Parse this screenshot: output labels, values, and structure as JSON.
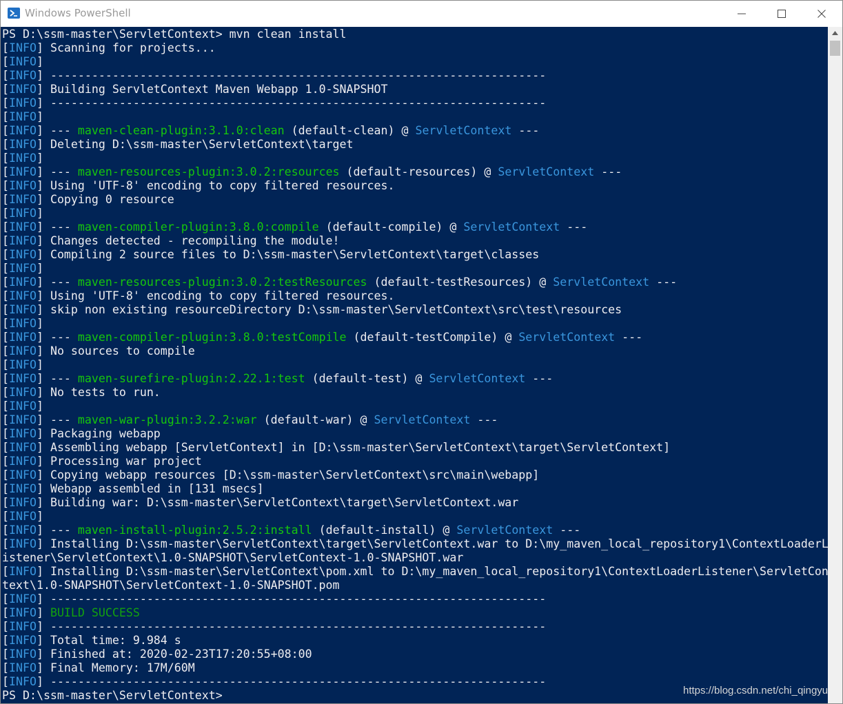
{
  "window": {
    "title": "Windows PowerShell",
    "app_icon": "powershell-icon",
    "controls": [
      "minimize-icon",
      "maximize-icon",
      "close-icon"
    ]
  },
  "colors": {
    "console_bg": "#012456",
    "text": "#eeedf0",
    "info_tag": "#3a96dd",
    "plugin": "#16c60c",
    "success": "#13a10e",
    "project": "#3a96dd"
  },
  "console": {
    "lines": [
      [
        {
          "t": "PS D:\\ssm-master\\ServletContext> mvn clean install",
          "c": "normal"
        }
      ],
      [
        {
          "t": "[",
          "c": "normal"
        },
        {
          "t": "INFO",
          "c": "blue"
        },
        {
          "t": "] Scanning for projects...",
          "c": "normal"
        }
      ],
      [
        {
          "t": "[",
          "c": "normal"
        },
        {
          "t": "INFO",
          "c": "blue"
        },
        {
          "t": "]",
          "c": "normal"
        }
      ],
      [
        {
          "t": "[",
          "c": "normal"
        },
        {
          "t": "INFO",
          "c": "blue"
        },
        {
          "t": "] ------------------------------------------------------------------------",
          "c": "normal"
        }
      ],
      [
        {
          "t": "[",
          "c": "normal"
        },
        {
          "t": "INFO",
          "c": "blue"
        },
        {
          "t": "] Building ServletContext Maven Webapp 1.0-SNAPSHOT",
          "c": "normal"
        }
      ],
      [
        {
          "t": "[",
          "c": "normal"
        },
        {
          "t": "INFO",
          "c": "blue"
        },
        {
          "t": "] ------------------------------------------------------------------------",
          "c": "normal"
        }
      ],
      [
        {
          "t": "[",
          "c": "normal"
        },
        {
          "t": "INFO",
          "c": "blue"
        },
        {
          "t": "]",
          "c": "normal"
        }
      ],
      [
        {
          "t": "[",
          "c": "normal"
        },
        {
          "t": "INFO",
          "c": "blue"
        },
        {
          "t": "] --- ",
          "c": "normal"
        },
        {
          "t": "maven-clean-plugin:3.1.0:clean",
          "c": "plug"
        },
        {
          "t": " (default-clean) @ ",
          "c": "normal"
        },
        {
          "t": "ServletContext",
          "c": "blue"
        },
        {
          "t": " ---",
          "c": "normal"
        }
      ],
      [
        {
          "t": "[",
          "c": "normal"
        },
        {
          "t": "INFO",
          "c": "blue"
        },
        {
          "t": "] Deleting D:\\ssm-master\\ServletContext\\target",
          "c": "normal"
        }
      ],
      [
        {
          "t": "[",
          "c": "normal"
        },
        {
          "t": "INFO",
          "c": "blue"
        },
        {
          "t": "]",
          "c": "normal"
        }
      ],
      [
        {
          "t": "[",
          "c": "normal"
        },
        {
          "t": "INFO",
          "c": "blue"
        },
        {
          "t": "] --- ",
          "c": "normal"
        },
        {
          "t": "maven-resources-plugin:3.0.2:resources",
          "c": "plug"
        },
        {
          "t": " (default-resources) @ ",
          "c": "normal"
        },
        {
          "t": "ServletContext",
          "c": "blue"
        },
        {
          "t": " ---",
          "c": "normal"
        }
      ],
      [
        {
          "t": "[",
          "c": "normal"
        },
        {
          "t": "INFO",
          "c": "blue"
        },
        {
          "t": "] Using 'UTF-8' encoding to copy filtered resources.",
          "c": "normal"
        }
      ],
      [
        {
          "t": "[",
          "c": "normal"
        },
        {
          "t": "INFO",
          "c": "blue"
        },
        {
          "t": "] Copying 0 resource",
          "c": "normal"
        }
      ],
      [
        {
          "t": "[",
          "c": "normal"
        },
        {
          "t": "INFO",
          "c": "blue"
        },
        {
          "t": "]",
          "c": "normal"
        }
      ],
      [
        {
          "t": "[",
          "c": "normal"
        },
        {
          "t": "INFO",
          "c": "blue"
        },
        {
          "t": "] --- ",
          "c": "normal"
        },
        {
          "t": "maven-compiler-plugin:3.8.0:compile",
          "c": "plug"
        },
        {
          "t": " (default-compile) @ ",
          "c": "normal"
        },
        {
          "t": "ServletContext",
          "c": "blue"
        },
        {
          "t": " ---",
          "c": "normal"
        }
      ],
      [
        {
          "t": "[",
          "c": "normal"
        },
        {
          "t": "INFO",
          "c": "blue"
        },
        {
          "t": "] Changes detected - recompiling the module!",
          "c": "normal"
        }
      ],
      [
        {
          "t": "[",
          "c": "normal"
        },
        {
          "t": "INFO",
          "c": "blue"
        },
        {
          "t": "] Compiling 2 source files to D:\\ssm-master\\ServletContext\\target\\classes",
          "c": "normal"
        }
      ],
      [
        {
          "t": "[",
          "c": "normal"
        },
        {
          "t": "INFO",
          "c": "blue"
        },
        {
          "t": "]",
          "c": "normal"
        }
      ],
      [
        {
          "t": "[",
          "c": "normal"
        },
        {
          "t": "INFO",
          "c": "blue"
        },
        {
          "t": "] --- ",
          "c": "normal"
        },
        {
          "t": "maven-resources-plugin:3.0.2:testResources",
          "c": "plug"
        },
        {
          "t": " (default-testResources) @ ",
          "c": "normal"
        },
        {
          "t": "ServletContext",
          "c": "blue"
        },
        {
          "t": " ---",
          "c": "normal"
        }
      ],
      [
        {
          "t": "[",
          "c": "normal"
        },
        {
          "t": "INFO",
          "c": "blue"
        },
        {
          "t": "] Using 'UTF-8' encoding to copy filtered resources.",
          "c": "normal"
        }
      ],
      [
        {
          "t": "[",
          "c": "normal"
        },
        {
          "t": "INFO",
          "c": "blue"
        },
        {
          "t": "] skip non existing resourceDirectory D:\\ssm-master\\ServletContext\\src\\test\\resources",
          "c": "normal"
        }
      ],
      [
        {
          "t": "[",
          "c": "normal"
        },
        {
          "t": "INFO",
          "c": "blue"
        },
        {
          "t": "]",
          "c": "normal"
        }
      ],
      [
        {
          "t": "[",
          "c": "normal"
        },
        {
          "t": "INFO",
          "c": "blue"
        },
        {
          "t": "] --- ",
          "c": "normal"
        },
        {
          "t": "maven-compiler-plugin:3.8.0:testCompile",
          "c": "plug"
        },
        {
          "t": " (default-testCompile) @ ",
          "c": "normal"
        },
        {
          "t": "ServletContext",
          "c": "blue"
        },
        {
          "t": " ---",
          "c": "normal"
        }
      ],
      [
        {
          "t": "[",
          "c": "normal"
        },
        {
          "t": "INFO",
          "c": "blue"
        },
        {
          "t": "] No sources to compile",
          "c": "normal"
        }
      ],
      [
        {
          "t": "[",
          "c": "normal"
        },
        {
          "t": "INFO",
          "c": "blue"
        },
        {
          "t": "]",
          "c": "normal"
        }
      ],
      [
        {
          "t": "[",
          "c": "normal"
        },
        {
          "t": "INFO",
          "c": "blue"
        },
        {
          "t": "] --- ",
          "c": "normal"
        },
        {
          "t": "maven-surefire-plugin:2.22.1:test",
          "c": "plug"
        },
        {
          "t": " (default-test) @ ",
          "c": "normal"
        },
        {
          "t": "ServletContext",
          "c": "blue"
        },
        {
          "t": " ---",
          "c": "normal"
        }
      ],
      [
        {
          "t": "[",
          "c": "normal"
        },
        {
          "t": "INFO",
          "c": "blue"
        },
        {
          "t": "] No tests to run.",
          "c": "normal"
        }
      ],
      [
        {
          "t": "[",
          "c": "normal"
        },
        {
          "t": "INFO",
          "c": "blue"
        },
        {
          "t": "]",
          "c": "normal"
        }
      ],
      [
        {
          "t": "[",
          "c": "normal"
        },
        {
          "t": "INFO",
          "c": "blue"
        },
        {
          "t": "] --- ",
          "c": "normal"
        },
        {
          "t": "maven-war-plugin:3.2.2:war",
          "c": "plug"
        },
        {
          "t": " (default-war) @ ",
          "c": "normal"
        },
        {
          "t": "ServletContext",
          "c": "blue"
        },
        {
          "t": " ---",
          "c": "normal"
        }
      ],
      [
        {
          "t": "[",
          "c": "normal"
        },
        {
          "t": "INFO",
          "c": "blue"
        },
        {
          "t": "] Packaging webapp",
          "c": "normal"
        }
      ],
      [
        {
          "t": "[",
          "c": "normal"
        },
        {
          "t": "INFO",
          "c": "blue"
        },
        {
          "t": "] Assembling webapp [ServletContext] in [D:\\ssm-master\\ServletContext\\target\\ServletContext]",
          "c": "normal"
        }
      ],
      [
        {
          "t": "[",
          "c": "normal"
        },
        {
          "t": "INFO",
          "c": "blue"
        },
        {
          "t": "] Processing war project",
          "c": "normal"
        }
      ],
      [
        {
          "t": "[",
          "c": "normal"
        },
        {
          "t": "INFO",
          "c": "blue"
        },
        {
          "t": "] Copying webapp resources [D:\\ssm-master\\ServletContext\\src\\main\\webapp]",
          "c": "normal"
        }
      ],
      [
        {
          "t": "[",
          "c": "normal"
        },
        {
          "t": "INFO",
          "c": "blue"
        },
        {
          "t": "] Webapp assembled in [131 msecs]",
          "c": "normal"
        }
      ],
      [
        {
          "t": "[",
          "c": "normal"
        },
        {
          "t": "INFO",
          "c": "blue"
        },
        {
          "t": "] Building war: D:\\ssm-master\\ServletContext\\target\\ServletContext.war",
          "c": "normal"
        }
      ],
      [
        {
          "t": "[",
          "c": "normal"
        },
        {
          "t": "INFO",
          "c": "blue"
        },
        {
          "t": "]",
          "c": "normal"
        }
      ],
      [
        {
          "t": "[",
          "c": "normal"
        },
        {
          "t": "INFO",
          "c": "blue"
        },
        {
          "t": "] --- ",
          "c": "normal"
        },
        {
          "t": "maven-install-plugin:2.5.2:install",
          "c": "plug"
        },
        {
          "t": " (default-install) @ ",
          "c": "normal"
        },
        {
          "t": "ServletContext",
          "c": "blue"
        },
        {
          "t": " ---",
          "c": "normal"
        }
      ],
      [
        {
          "t": "[",
          "c": "normal"
        },
        {
          "t": "INFO",
          "c": "blue"
        },
        {
          "t": "] Installing D:\\ssm-master\\ServletContext\\target\\ServletContext.war to D:\\my_maven_local_repository1\\ContextLoaderL",
          "c": "normal"
        }
      ],
      [
        {
          "t": "istener\\ServletContext\\1.0-SNAPSHOT\\ServletContext-1.0-SNAPSHOT.war",
          "c": "normal"
        }
      ],
      [
        {
          "t": "[",
          "c": "normal"
        },
        {
          "t": "INFO",
          "c": "blue"
        },
        {
          "t": "] Installing D:\\ssm-master\\ServletContext\\pom.xml to D:\\my_maven_local_repository1\\ContextLoaderListener\\ServletCon",
          "c": "normal"
        }
      ],
      [
        {
          "t": "text\\1.0-SNAPSHOT\\ServletContext-1.0-SNAPSHOT.pom",
          "c": "normal"
        }
      ],
      [
        {
          "t": "[",
          "c": "normal"
        },
        {
          "t": "INFO",
          "c": "blue"
        },
        {
          "t": "] ------------------------------------------------------------------------",
          "c": "normal"
        }
      ],
      [
        {
          "t": "[",
          "c": "normal"
        },
        {
          "t": "INFO",
          "c": "blue"
        },
        {
          "t": "] ",
          "c": "normal"
        },
        {
          "t": "BUILD SUCCESS",
          "c": "green"
        }
      ],
      [
        {
          "t": "[",
          "c": "normal"
        },
        {
          "t": "INFO",
          "c": "blue"
        },
        {
          "t": "] ------------------------------------------------------------------------",
          "c": "normal"
        }
      ],
      [
        {
          "t": "[",
          "c": "normal"
        },
        {
          "t": "INFO",
          "c": "blue"
        },
        {
          "t": "] Total time: 9.984 s",
          "c": "normal"
        }
      ],
      [
        {
          "t": "[",
          "c": "normal"
        },
        {
          "t": "INFO",
          "c": "blue"
        },
        {
          "t": "] Finished at: 2020-02-23T17:20:55+08:00",
          "c": "normal"
        }
      ],
      [
        {
          "t": "[",
          "c": "normal"
        },
        {
          "t": "INFO",
          "c": "blue"
        },
        {
          "t": "] Final Memory: 17M/60M",
          "c": "normal"
        }
      ],
      [
        {
          "t": "[",
          "c": "normal"
        },
        {
          "t": "INFO",
          "c": "blue"
        },
        {
          "t": "] ------------------------------------------------------------------------",
          "c": "normal"
        }
      ],
      [
        {
          "t": "PS D:\\ssm-master\\ServletContext>",
          "c": "normal"
        }
      ]
    ]
  },
  "watermark": "https://blog.csdn.net/chi_qingyu",
  "scrollbar": {
    "up_icon": "scroll-up-arrow-icon"
  }
}
